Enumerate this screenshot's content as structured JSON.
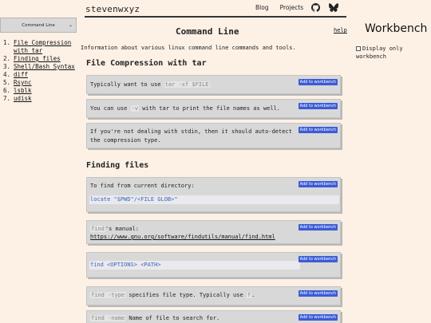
{
  "site": {
    "name": "stevenwxyz"
  },
  "header_nav": {
    "blog": "Blog",
    "projects": "Projects",
    "github_icon": "github-icon",
    "bluesky_icon": "butterfly-icon"
  },
  "left_nav": {
    "select_value": "Command Line",
    "toc": [
      {
        "num": "1.",
        "label": "File Compression with tar"
      },
      {
        "num": "2.",
        "label": "Finding files"
      },
      {
        "num": "3.",
        "label": "Shell/Bash Syntax"
      },
      {
        "num": "4.",
        "label": "diff"
      },
      {
        "num": "5.",
        "label": "Rsync"
      },
      {
        "num": "6.",
        "label": "lsblk"
      },
      {
        "num": "7.",
        "label": "udisk"
      }
    ]
  },
  "main": {
    "title": "Command Line",
    "help": "help",
    "intro": "Information about various linux command line commands and tools.",
    "button_label": "Add to workbench",
    "sections": [
      {
        "heading": "File Compression with tar",
        "cards": [
          {
            "pre": "Typically want to use ",
            "code": "tar -xf $FILE",
            "post": ""
          },
          {
            "pre": "You can use ",
            "code": "-v",
            "post": " with tar to print the file names as well."
          },
          {
            "line1": "If you're not dealing with stdin, then it should auto-detect",
            "line2": "the compression type."
          }
        ]
      },
      {
        "heading": "Finding files",
        "cards": [
          {
            "text": "To find from current directory:",
            "code": "locate \"$PWD\"/<FILE GLOB>\""
          },
          {
            "code": "find",
            "post": "'s manual:",
            "url": "https://www.gnu.org/software/findutils/manual/find.html"
          },
          {
            "code": "find <OPTIONS> <PATH>"
          },
          {
            "code": "find -type",
            "post": " specifies file type. Typically use ",
            "code2": "f",
            "post2": "."
          },
          {
            "code": "find -name",
            "post": " Name of file to search for."
          }
        ]
      }
    ]
  },
  "workbench": {
    "title": "Workbench",
    "checkbox_label": "Display only workbench",
    "checked": false
  }
}
